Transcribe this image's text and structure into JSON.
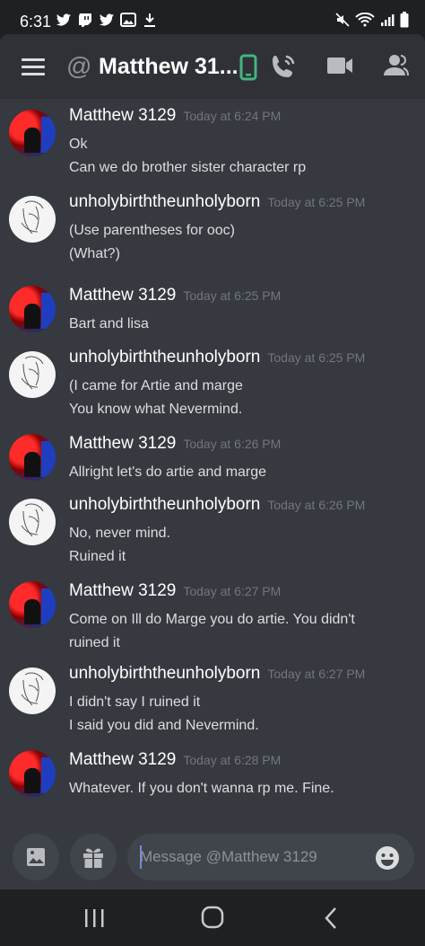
{
  "status_bar": {
    "time": "6:31"
  },
  "header": {
    "title": "Matthew 31...",
    "icons": [
      "menu-icon",
      "at-icon",
      "phone-status-icon",
      "voice-call-icon",
      "video-call-icon",
      "members-icon"
    ]
  },
  "messages": [
    {
      "author": "Matthew 3129",
      "time": "Today at 6:24 PM",
      "avatar": "red",
      "lines": [
        "Ok",
        "Can we do brother sister character rp"
      ]
    },
    {
      "author": "unholybirththeunholyborn",
      "time": "Today at 6:25 PM",
      "avatar": "sketch",
      "lines": [
        "(Use parentheses for ooc)",
        "(What?)"
      ]
    },
    {
      "author": "Matthew 3129",
      "time": "Today at 6:25 PM",
      "avatar": "red",
      "lines": [
        "Bart and lisa"
      ]
    },
    {
      "author": "unholybirththeunholyborn",
      "time": "Today at 6:25 PM",
      "avatar": "sketch",
      "lines": [
        "(I came for Artie and marge",
        "You know what Nevermind."
      ]
    },
    {
      "author": "Matthew 3129",
      "time": "Today at 6:26 PM",
      "avatar": "red",
      "lines": [
        "Allright let's do artie and marge"
      ]
    },
    {
      "author": "unholybirththeunholyborn",
      "time": "Today at 6:26 PM",
      "avatar": "sketch",
      "lines": [
        "No, never mind.",
        "Ruined it"
      ]
    },
    {
      "author": "Matthew 3129",
      "time": "Today at 6:27 PM",
      "avatar": "red",
      "lines": [
        "Come on Ill do Marge you do artie. You didn't",
        "ruined it"
      ]
    },
    {
      "author": "unholybirththeunholyborn",
      "time": "Today at 6:27 PM",
      "avatar": "sketch",
      "lines": [
        "I didn't say I ruined it",
        "I said you did and Nevermind."
      ]
    },
    {
      "author": "Matthew 3129",
      "time": "Today at 6:28 PM",
      "avatar": "red",
      "lines": [
        "Whatever. If you don't wanna rp me. Fine."
      ]
    }
  ],
  "composer": {
    "placeholder": "Message @Matthew 3129"
  },
  "colors": {
    "background": "#36393f",
    "header": "#2f3136",
    "accent": "#7289da",
    "online_green": "#43b581"
  }
}
